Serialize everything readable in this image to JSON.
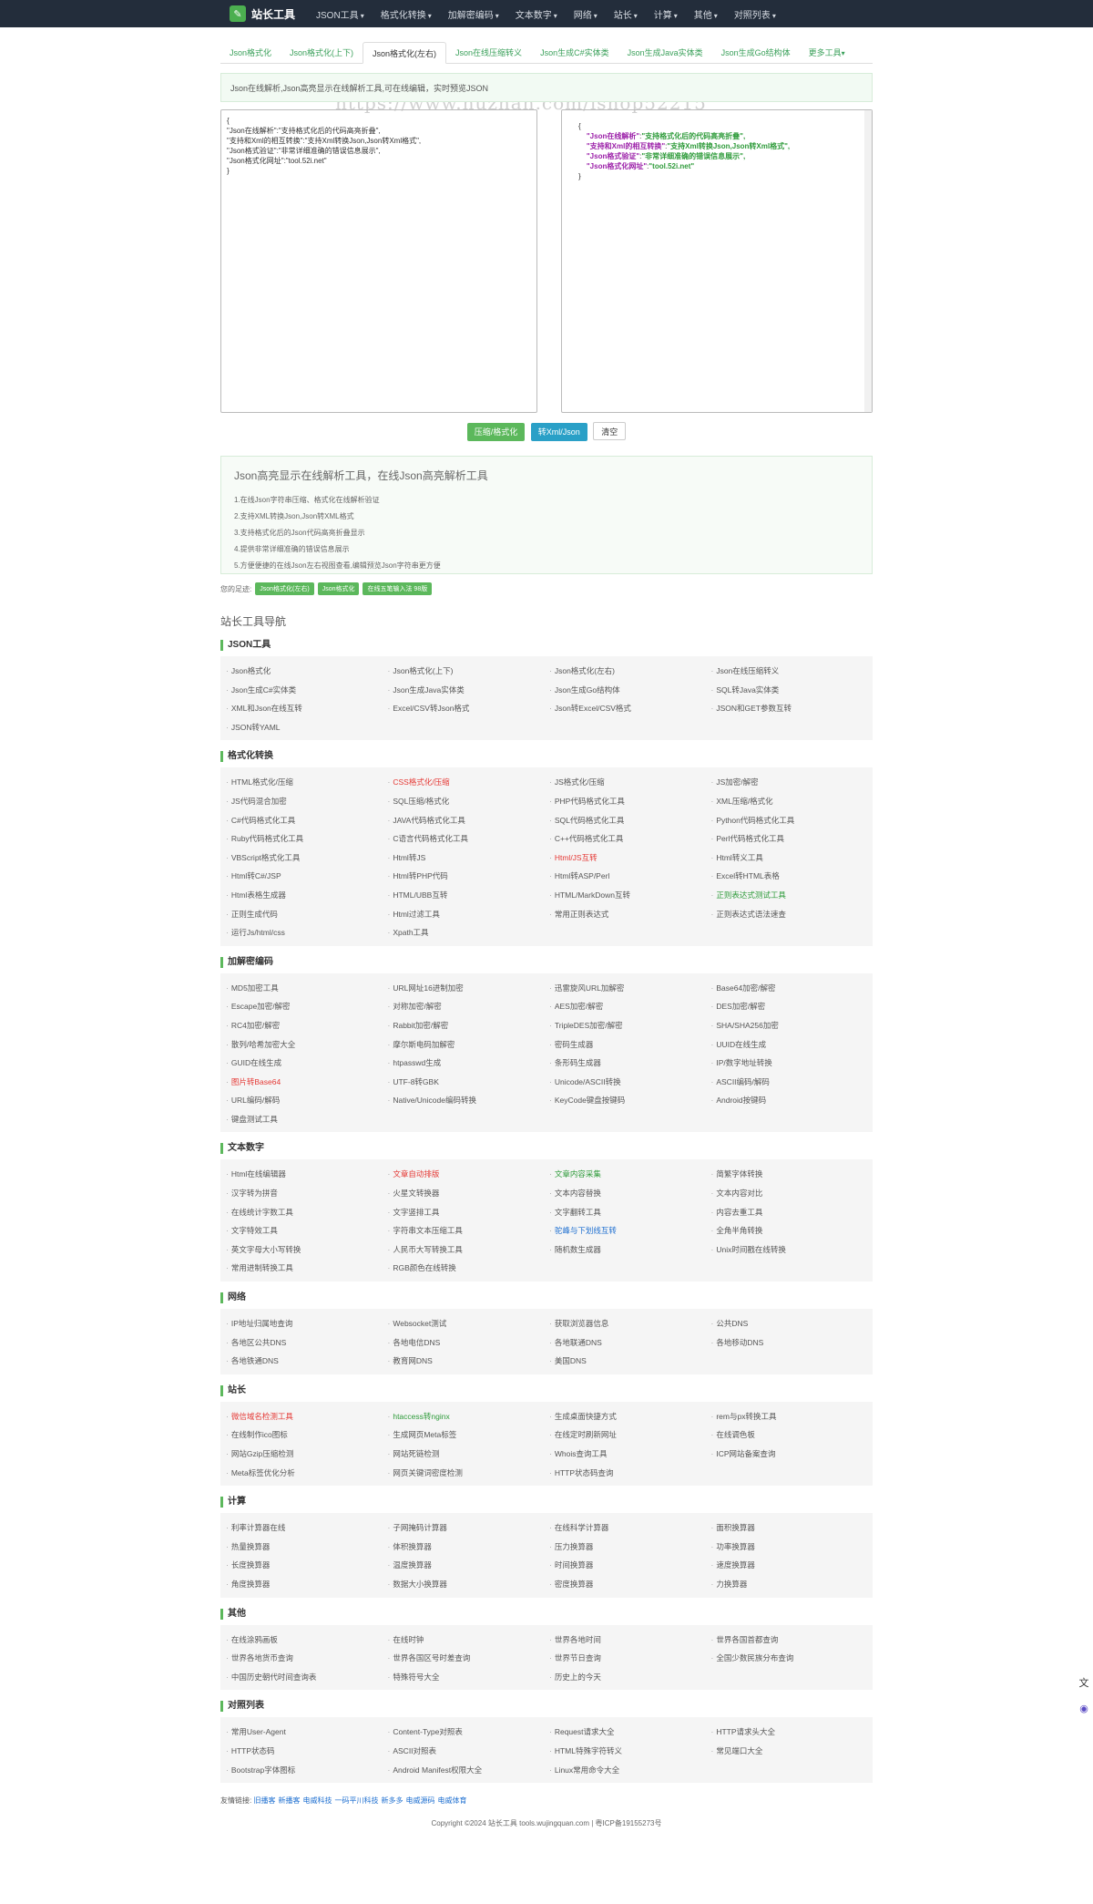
{
  "header": {
    "brand": "站长工具",
    "brand_icon": "wrench-icon",
    "menu": [
      "JSON工具",
      "格式化转换",
      "加解密编码",
      "文本数字",
      "网络",
      "站长",
      "计算",
      "其他",
      "对照列表"
    ]
  },
  "tabs": [
    "Json格式化",
    "Json格式化(上下)",
    "Json格式化(左右)",
    "Json在线压缩转义",
    "Json生成C#实体类",
    "Json生成Java实体类",
    "Json生成Go结构体",
    "更多工具"
  ],
  "active_tab": "Json格式化(左右)",
  "notice": "Json在线解析,Json高亮显示在线解析工具,可在线编辑，实时预览JSON",
  "watermark": "https://www.huzhan.com/ishop52215",
  "input_lines": [
    "{",
    "\"Json在线解析\":\"支持格式化后的代码高亮折叠\",",
    "\"支持和Xml的相互转换\":\"支持Xml转换Json,Json转Xml格式\",",
    "\"Json格式验证\":\"非常详细准确的错误信息展示\",",
    "\"Json格式化网址\":\"tool.52i.net\"",
    "}"
  ],
  "output": {
    "open": "{",
    "close": "}",
    "pairs": [
      {
        "k": "\"Json在线解析\"",
        "v": "\"支持格式化后的代码高亮折叠\","
      },
      {
        "k": "\"支持和Xml的相互转换\"",
        "v": "\"支持Xml转换Json,Json转Xml格式\","
      },
      {
        "k": "\"Json格式验证\"",
        "v": "\"非常详细准确的错误信息展示\","
      },
      {
        "k": "\"Json格式化网址\"",
        "v": "\"tool.52i.net\""
      }
    ]
  },
  "buttons": {
    "format": "压缩/格式化",
    "convert": "转Xml/Json",
    "clear": "清空"
  },
  "info": {
    "title": "Json高亮显示在线解析工具，在线Json高亮解析工具",
    "items": [
      "1.在线Json字符串压缩、格式化在线解析验证",
      "2.支持XML转换Json,Json转XML格式",
      "3.支持格式化后的Json代码高亮折叠显示",
      "4.提供非常详细准确的错误信息展示",
      "5.方便便捷的在线Json左右视图查看,编辑预览Json字符串更方便"
    ]
  },
  "footprint": {
    "label": "您的足迹:",
    "tags": [
      "Json格式化(左右)",
      "Json格式化",
      "在线五笔输入法 98版"
    ]
  },
  "nav_title": "站长工具导航",
  "sections": [
    {
      "title": "JSON工具",
      "items": [
        {
          "t": "Json格式化"
        },
        {
          "t": "Json格式化(上下)"
        },
        {
          "t": "Json格式化(左右)"
        },
        {
          "t": "Json在线压缩转义"
        },
        {
          "t": "Json生成C#实体类"
        },
        {
          "t": "Json生成Java实体类"
        },
        {
          "t": "Json生成Go结构体"
        },
        {
          "t": "SQL转Java实体类"
        },
        {
          "t": "XML和Json在线互转"
        },
        {
          "t": "Excel/CSV转Json格式"
        },
        {
          "t": "Json转Excel/CSV格式"
        },
        {
          "t": "JSON和GET参数互转"
        },
        {
          "t": "JSON转YAML"
        }
      ]
    },
    {
      "title": "格式化转换",
      "items": [
        {
          "t": "HTML格式化/压缩"
        },
        {
          "t": "CSS格式化/压缩",
          "c": "red"
        },
        {
          "t": "JS格式化/压缩"
        },
        {
          "t": "JS加密/解密"
        },
        {
          "t": "JS代码混合加密"
        },
        {
          "t": "SQL压缩/格式化"
        },
        {
          "t": "PHP代码格式化工具"
        },
        {
          "t": "XML压缩/格式化"
        },
        {
          "t": "C#代码格式化工具"
        },
        {
          "t": "JAVA代码格式化工具"
        },
        {
          "t": "SQL代码格式化工具"
        },
        {
          "t": "Python代码格式化工具"
        },
        {
          "t": "Ruby代码格式化工具"
        },
        {
          "t": "C语言代码格式化工具"
        },
        {
          "t": "C++代码格式化工具"
        },
        {
          "t": "Perl代码格式化工具"
        },
        {
          "t": "VBScript格式化工具"
        },
        {
          "t": "Html转JS"
        },
        {
          "t": "Html/JS互转",
          "c": "red"
        },
        {
          "t": "Html转义工具"
        },
        {
          "t": "Html转C#/JSP"
        },
        {
          "t": "Html转PHP代码"
        },
        {
          "t": "Html转ASP/Perl"
        },
        {
          "t": "Excel转HTML表格"
        },
        {
          "t": "Html表格生成器"
        },
        {
          "t": "HTML/UBB互转"
        },
        {
          "t": "HTML/MarkDown互转"
        },
        {
          "t": "正则表达式测试工具",
          "c": "green"
        },
        {
          "t": "正则生成代码"
        },
        {
          "t": "Html过滤工具"
        },
        {
          "t": "常用正则表达式"
        },
        {
          "t": "正则表达式语法速查"
        },
        {
          "t": "运行Js/html/css"
        },
        {
          "t": "Xpath工具"
        }
      ]
    },
    {
      "title": "加解密编码",
      "items": [
        {
          "t": "MD5加密工具"
        },
        {
          "t": "URL网址16进制加密"
        },
        {
          "t": "迅雷旋风URL加解密"
        },
        {
          "t": "Base64加密/解密"
        },
        {
          "t": "Escape加密/解密"
        },
        {
          "t": "对称加密/解密"
        },
        {
          "t": "AES加密/解密"
        },
        {
          "t": "DES加密/解密"
        },
        {
          "t": "RC4加密/解密"
        },
        {
          "t": "Rabbit加密/解密"
        },
        {
          "t": "TripleDES加密/解密"
        },
        {
          "t": "SHA/SHA256加密"
        },
        {
          "t": "散列/哈希加密大全"
        },
        {
          "t": "摩尔斯电码加解密"
        },
        {
          "t": "密码生成器"
        },
        {
          "t": "UUID在线生成"
        },
        {
          "t": "GUID在线生成"
        },
        {
          "t": "htpasswd生成"
        },
        {
          "t": "条形码生成器"
        },
        {
          "t": "IP/数字地址转换"
        },
        {
          "t": "图片转Base64",
          "c": "red"
        },
        {
          "t": "UTF-8转GBK"
        },
        {
          "t": "Unicode/ASCII转换"
        },
        {
          "t": "ASCII编码/解码"
        },
        {
          "t": "URL编码/解码"
        },
        {
          "t": "Native/Unicode编码转换"
        },
        {
          "t": "KeyCode键盘按键码"
        },
        {
          "t": "Android按键码"
        },
        {
          "t": "键盘测试工具"
        }
      ]
    },
    {
      "title": "文本数字",
      "items": [
        {
          "t": "Html在线编辑器"
        },
        {
          "t": "文章自动排版",
          "c": "red"
        },
        {
          "t": "文章内容采集",
          "c": "green"
        },
        {
          "t": "简繁字体转换"
        },
        {
          "t": "汉字转为拼音"
        },
        {
          "t": "火星文转换器"
        },
        {
          "t": "文本内容替换"
        },
        {
          "t": "文本内容对比"
        },
        {
          "t": "在线统计字数工具"
        },
        {
          "t": "文字竖排工具"
        },
        {
          "t": "文字翻转工具"
        },
        {
          "t": "内容去重工具"
        },
        {
          "t": "文字特效工具"
        },
        {
          "t": "字符串文本压缩工具"
        },
        {
          "t": "驼峰与下划线互转",
          "c": "blue"
        },
        {
          "t": "全角半角转换"
        },
        {
          "t": "英文字母大小写转换"
        },
        {
          "t": "人民币大写转换工具"
        },
        {
          "t": "随机数生成器"
        },
        {
          "t": "Unix时间戳在线转换"
        },
        {
          "t": "常用进制转换工具"
        },
        {
          "t": "RGB颜色在线转换"
        }
      ]
    },
    {
      "title": "网络",
      "items": [
        {
          "t": "IP地址归属地查询"
        },
        {
          "t": "Websocket测试"
        },
        {
          "t": "获取浏览器信息"
        },
        {
          "t": "公共DNS"
        },
        {
          "t": "各地区公共DNS"
        },
        {
          "t": "各地电信DNS"
        },
        {
          "t": "各地联通DNS"
        },
        {
          "t": "各地移动DNS"
        },
        {
          "t": "各地铁通DNS"
        },
        {
          "t": "教育网DNS"
        },
        {
          "t": "美国DNS"
        }
      ]
    },
    {
      "title": "站长",
      "items": [
        {
          "t": "微信域名检测工具",
          "c": "red"
        },
        {
          "t": "htaccess转nginx",
          "c": "green"
        },
        {
          "t": "生成桌面快捷方式"
        },
        {
          "t": "rem与px转换工具"
        },
        {
          "t": "在线制作ico图标"
        },
        {
          "t": "生成网页Meta标签"
        },
        {
          "t": "在线定时刷新网址"
        },
        {
          "t": "在线调色板"
        },
        {
          "t": "网站Gzip压缩检测"
        },
        {
          "t": "网站死链检测"
        },
        {
          "t": "Whois查询工具"
        },
        {
          "t": "ICP网站备案查询"
        },
        {
          "t": "Meta标签优化分析"
        },
        {
          "t": "网页关键词密度检测"
        },
        {
          "t": "HTTP状态码查询"
        }
      ]
    },
    {
      "title": "计算",
      "items": [
        {
          "t": "利率计算器在线"
        },
        {
          "t": "子网掩码计算器"
        },
        {
          "t": "在线科学计算器"
        },
        {
          "t": "面积换算器"
        },
        {
          "t": "热量换算器"
        },
        {
          "t": "体积换算器"
        },
        {
          "t": "压力换算器"
        },
        {
          "t": "功率换算器"
        },
        {
          "t": "长度换算器"
        },
        {
          "t": "温度换算器"
        },
        {
          "t": "时间换算器"
        },
        {
          "t": "速度换算器"
        },
        {
          "t": "角度换算器"
        },
        {
          "t": "数据大小换算器"
        },
        {
          "t": "密度换算器"
        },
        {
          "t": "力换算器"
        }
      ]
    },
    {
      "title": "其他",
      "items": [
        {
          "t": "在线涂鸦画板"
        },
        {
          "t": "在线时钟"
        },
        {
          "t": "世界各地时间"
        },
        {
          "t": "世界各国首都查询"
        },
        {
          "t": "世界各地货币查询"
        },
        {
          "t": "世界各国区号时差查询"
        },
        {
          "t": "世界节日查询"
        },
        {
          "t": "全国少数民族分布查询"
        },
        {
          "t": "中国历史朝代时间查询表"
        },
        {
          "t": "特殊符号大全"
        },
        {
          "t": "历史上的今天"
        }
      ]
    },
    {
      "title": "对照列表",
      "items": [
        {
          "t": "常用User-Agent"
        },
        {
          "t": "Content-Type对照表"
        },
        {
          "t": "Request请求大全"
        },
        {
          "t": "HTTP请求头大全"
        },
        {
          "t": "HTTP状态码"
        },
        {
          "t": "ASCII对照表"
        },
        {
          "t": "HTML特殊字符转义"
        },
        {
          "t": "常见端口大全"
        },
        {
          "t": "Bootstrap字体图标"
        },
        {
          "t": "Android Manifest权限大全"
        },
        {
          "t": "Linux常用命令大全"
        }
      ]
    }
  ],
  "friend_links": {
    "label": "友情链接:",
    "items": [
      "旧播客",
      "新播客",
      "电威科技",
      "一码平川科技",
      "新多多",
      "电威源码",
      "电威体育"
    ]
  },
  "copyright": "Copyright ©2024 站长工具 tools.wujingquan.com  |  粤ICP备19155273号",
  "side_icons": [
    "translate-icon",
    "ai-assistant-icon"
  ]
}
